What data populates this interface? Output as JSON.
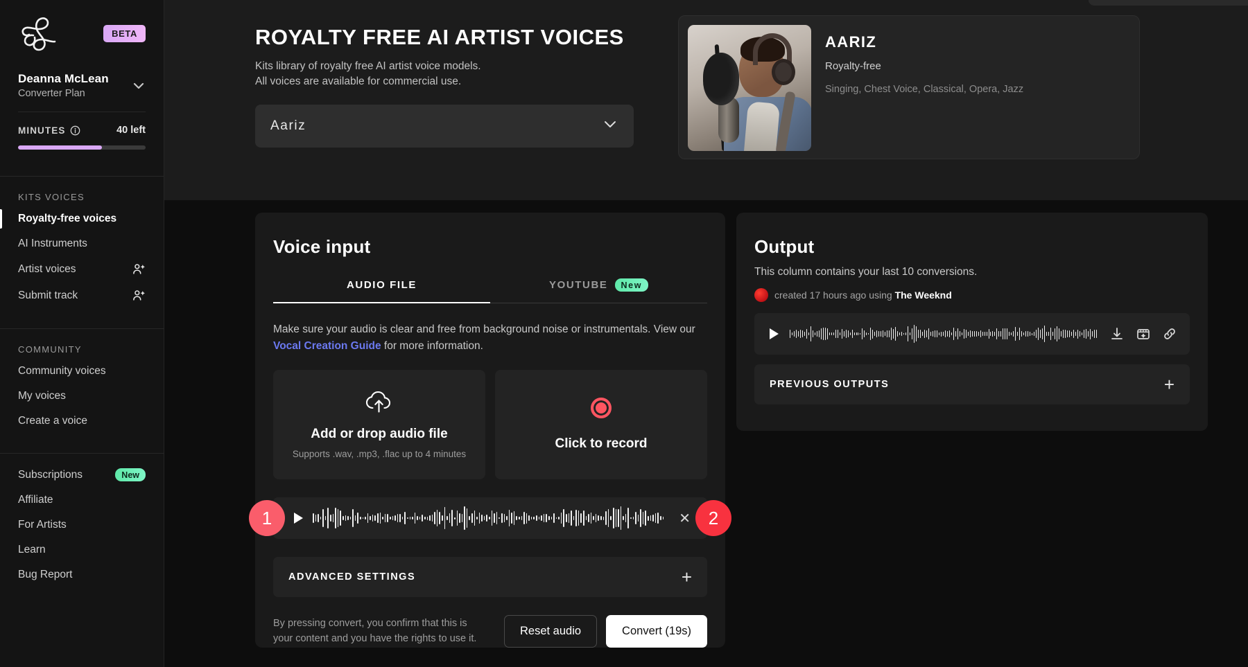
{
  "sidebar": {
    "brand_logo": "kits-ampersand-logo",
    "beta_label": "BETA",
    "user_name": "Deanna McLean",
    "user_plan": "Converter Plan",
    "minutes_label": "MINUTES",
    "minutes_left": "40 left",
    "minutes_percent": 66,
    "sections": [
      {
        "title": "KITS VOICES",
        "items": [
          {
            "label": "Royalty-free voices",
            "active": true,
            "icon": "",
            "badge": ""
          },
          {
            "label": "AI Instruments",
            "active": false,
            "icon": "",
            "badge": ""
          },
          {
            "label": "Artist voices",
            "active": false,
            "icon": "user-sparkle-icon",
            "badge": ""
          },
          {
            "label": "Submit track",
            "active": false,
            "icon": "user-sparkle-icon",
            "badge": ""
          }
        ]
      },
      {
        "title": "COMMUNITY",
        "items": [
          {
            "label": "Community voices",
            "active": false,
            "icon": "",
            "badge": ""
          },
          {
            "label": "My voices",
            "active": false,
            "icon": "",
            "badge": ""
          },
          {
            "label": "Create a voice",
            "active": false,
            "icon": "",
            "badge": ""
          }
        ]
      },
      {
        "title": "",
        "items": [
          {
            "label": "Subscriptions",
            "active": false,
            "icon": "",
            "badge": "New"
          },
          {
            "label": "Affiliate",
            "active": false,
            "icon": "",
            "badge": ""
          },
          {
            "label": "For Artists",
            "active": false,
            "icon": "",
            "badge": ""
          },
          {
            "label": "Learn",
            "active": false,
            "icon": "",
            "badge": ""
          },
          {
            "label": "Bug Report",
            "active": false,
            "icon": "",
            "badge": ""
          }
        ]
      }
    ]
  },
  "hero": {
    "title": "ROYALTY FREE AI ARTIST VOICES",
    "subtitle_line1": "Kits library of royalty free AI artist voice models.",
    "subtitle_line2": "All voices are available for commercial use.",
    "voice_select_value": "Aariz",
    "voice_select_icon": "chevron-down-icon"
  },
  "artist_card": {
    "name": "AARIZ",
    "license": "Royalty-free",
    "tags": "Singing, Chest Voice, Classical, Opera, Jazz",
    "image_alt": "singer-at-microphone-photo"
  },
  "voice_input": {
    "heading": "Voice input",
    "tabs": [
      {
        "label": "AUDIO FILE",
        "active": true,
        "badge": ""
      },
      {
        "label": "YOUTUBE",
        "active": false,
        "badge": "New"
      }
    ],
    "hint_prefix": "Make sure your audio is clear and free from background noise or instrumentals. View our ",
    "hint_link": "Vocal Creation Guide",
    "hint_suffix": " for more information.",
    "upload_card": {
      "icon": "cloud-upload-icon",
      "title": "Add or drop audio file",
      "subtitle": "Supports .wav, .mp3, .flac up to 4 minutes"
    },
    "record_card": {
      "icon": "record-circle-icon",
      "title": "Click to record"
    },
    "player": {
      "play_icon": "play-icon",
      "close_icon": "close-icon",
      "waveform": "input-audio-waveform"
    },
    "annotations": [
      {
        "number": "1",
        "color": "#fa5d6b"
      },
      {
        "number": "2",
        "color": "#f8323f"
      }
    ],
    "advanced_settings": {
      "label": "ADVANCED SETTINGS",
      "expand_icon": "plus-icon"
    },
    "footer_note": "By pressing convert, you confirm that this is your content and you have the rights to use it.",
    "reset_button": "Reset audio",
    "convert_button": "Convert (19s)"
  },
  "output": {
    "heading": "Output",
    "subtitle": "This column contains your last 10 conversions.",
    "meta_prefix": "created 17 hours ago using ",
    "meta_voice": "The Weeknd",
    "player": {
      "play_icon": "play-icon",
      "waveform": "output-audio-waveform",
      "actions": [
        "download-icon",
        "stem-split-icon",
        "link-icon"
      ]
    },
    "previous_outputs": {
      "label": "PREVIOUS OUTPUTS",
      "expand_icon": "plus-icon"
    }
  }
}
